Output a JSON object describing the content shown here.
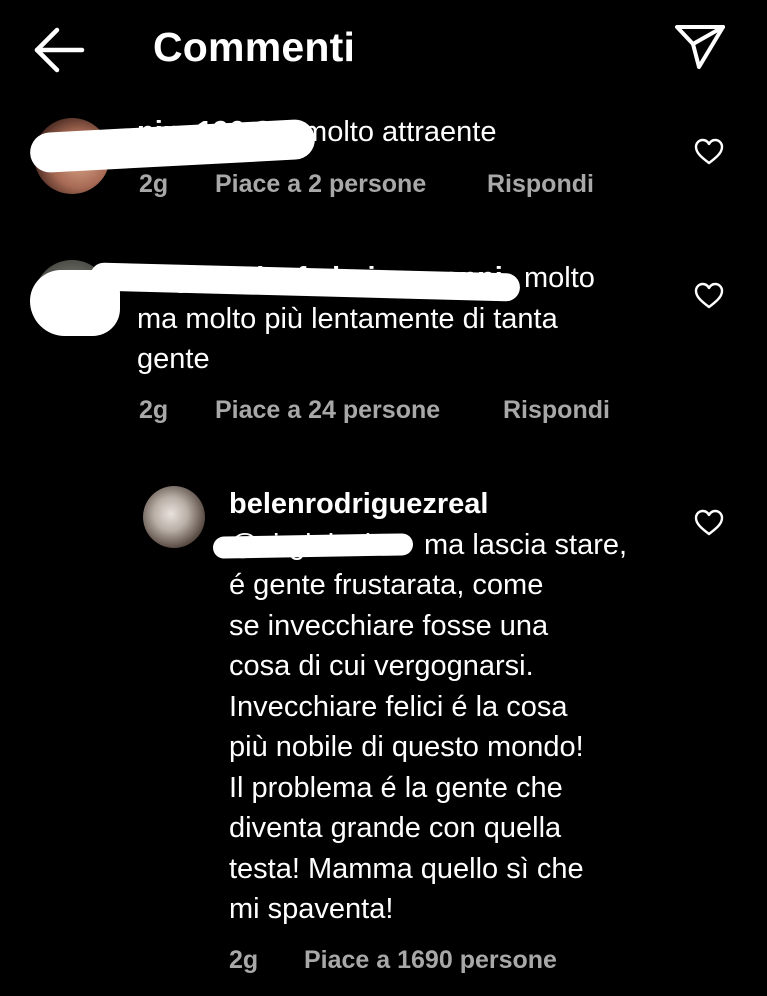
{
  "header": {
    "title": "Commenti"
  },
  "comments": [
    {
      "username": "pina196",
      "text": "Sei molto attraente",
      "time": "2g",
      "likes": "Piace a 2 persone",
      "reply": "Rispondi"
    },
    {
      "username": "virginiacia_federico_pappi",
      "text_line1": "molto",
      "text_line2": "ma molto più lentamente di tanta",
      "text_line3": "gente",
      "time": "2g",
      "likes": "Piace a 24 persone",
      "reply": "Rispondi"
    },
    {
      "username": "belenrodriguezreal",
      "mention": "@virginiacia",
      "lines": [
        "ma lascia stare,",
        "é gente frustarata, come",
        "se invecchiare fosse una",
        "cosa di cui vergognarsi.",
        "Invecchiare felici é la cosa",
        "più nobile di questo mondo!",
        "Il problema é la gente che",
        "diventa grande con quella",
        "testa! Mamma quello sì che",
        "mi spaventa!"
      ],
      "time": "2g",
      "likes": "Piace a 1690 persone"
    }
  ],
  "colors": {
    "background": "#000000",
    "text": "#ffffff",
    "meta": "#a8a8a8"
  }
}
